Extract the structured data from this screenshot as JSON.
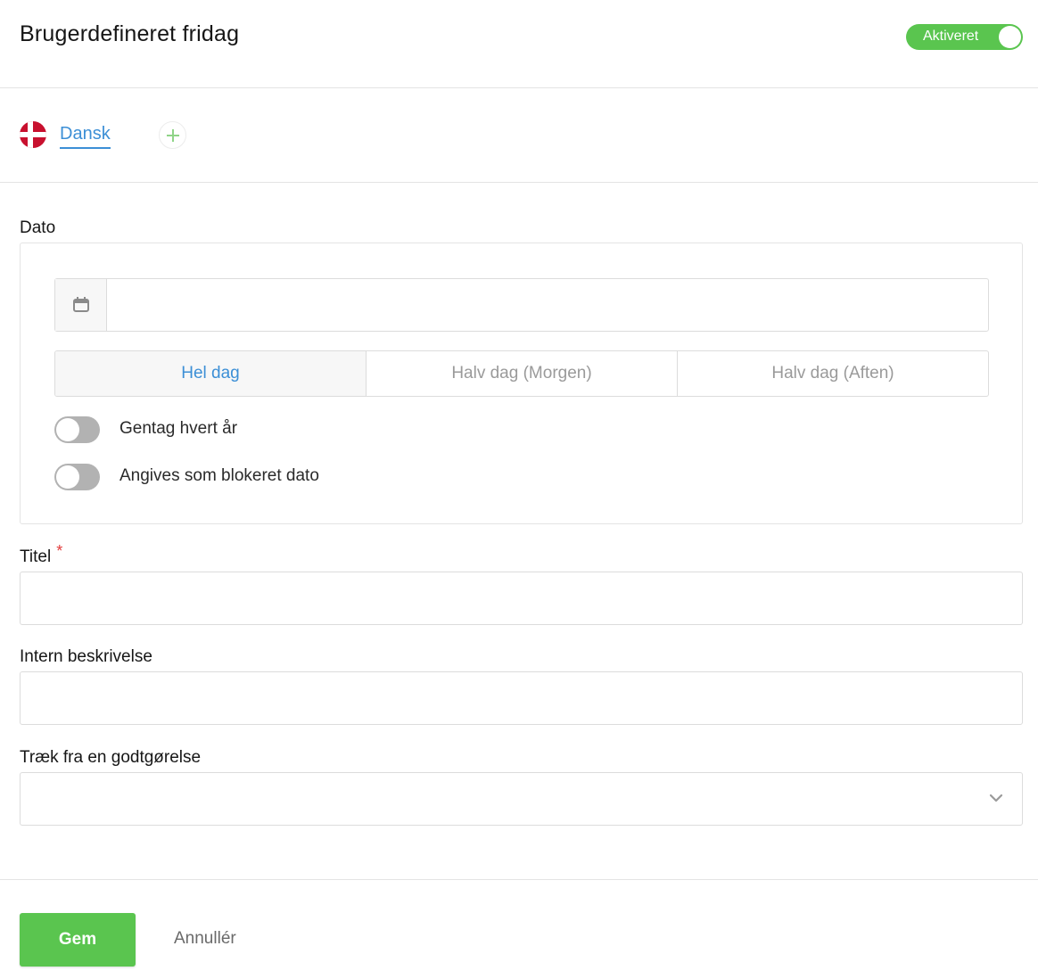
{
  "header": {
    "title": "Brugerdefineret fridag",
    "status_label": "Aktiveret"
  },
  "languages": {
    "active_tab": "Dansk"
  },
  "date_section": {
    "label": "Dato",
    "date_value": "",
    "duration_options": [
      "Hel dag",
      "Halv dag (Morgen)",
      "Halv dag (Aften)"
    ],
    "selected_option": "Hel dag",
    "repeat_label": "Gentag hvert år",
    "repeat_on": false,
    "blocked_label": "Angives som blokeret dato",
    "blocked_on": false
  },
  "title_field": {
    "label": "Titel",
    "required_mark": "*",
    "value": ""
  },
  "description_field": {
    "label": "Intern beskrivelse",
    "value": ""
  },
  "allowance_field": {
    "label": "Træk fra en godtgørelse",
    "value": ""
  },
  "footer": {
    "save_label": "Gem",
    "cancel_label": "Annullér"
  },
  "colors": {
    "accent_green": "#5ac54f",
    "link_blue": "#3c8fd6",
    "required_red": "#e23b3b",
    "flag_red": "#c8102e"
  },
  "icons": {
    "flag": "denmark-flag-icon",
    "add": "plus-icon",
    "calendar": "calendar-icon",
    "select": "chevron-down-icon"
  }
}
